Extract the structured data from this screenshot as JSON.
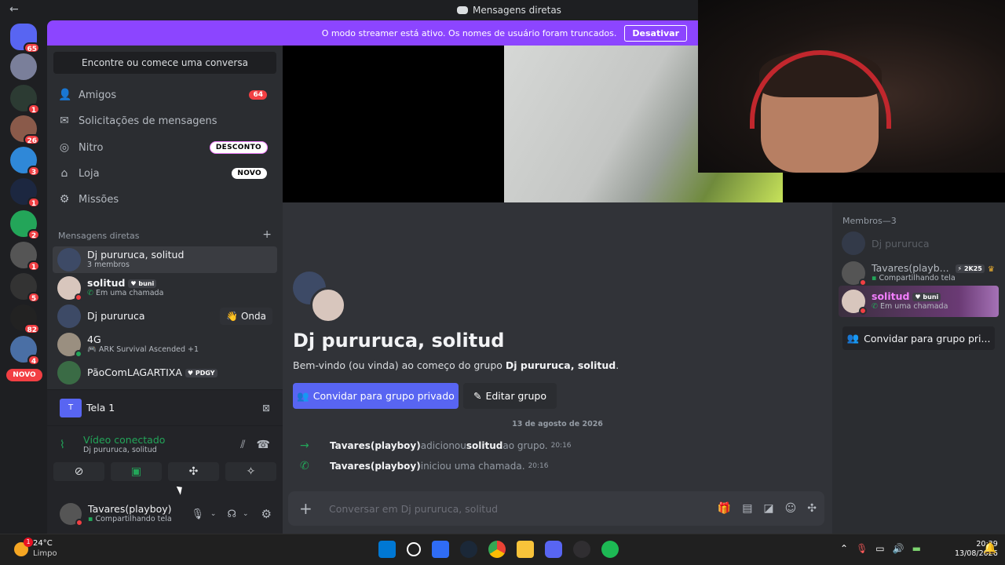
{
  "titlebar": {
    "back": "←",
    "title": "Mensagens diretas"
  },
  "rail": {
    "badges": [
      "65",
      "1",
      "26",
      "3",
      "1",
      "2",
      "1",
      "5",
      "82",
      "4"
    ],
    "new_label": "NOVO"
  },
  "banner": {
    "text": "O modo streamer está ativo. Os nomes de usuário foram truncados.",
    "button": "Desativar"
  },
  "sidebar": {
    "search": "Encontre ou comece uma conversa",
    "nav": [
      {
        "label": "Amigos",
        "badge": "64",
        "icon": "friends-icon"
      },
      {
        "label": "Solicitações de mensagens",
        "icon": "mail-icon"
      },
      {
        "label": "Nitro",
        "badge": "DESCONTO",
        "icon": "nitro-icon"
      },
      {
        "label": "Loja",
        "badge": "NOVO",
        "icon": "shop-icon"
      },
      {
        "label": "Missões",
        "icon": "quests-icon"
      }
    ],
    "dm_header": "Mensagens diretas",
    "dm_add": "+",
    "dms": [
      {
        "name": "Dj pururuca, solitud",
        "sub": "3 membros"
      },
      {
        "name": "solitud",
        "tag": "buni",
        "sub": "Em uma chamada"
      },
      {
        "name": "Dj pururuca",
        "action": "Onda"
      },
      {
        "name": "4G",
        "sub": "ARK Survival Ascended +1"
      },
      {
        "name": "PãoComLAGARTIXA",
        "tag": "PDGY"
      }
    ]
  },
  "voice": {
    "screen_label": "Tela 1",
    "screen_icon_text": "T",
    "status": "Vídeo conectado",
    "channel": "Dj pururuca, solitud",
    "user_name": "Tavares(playboy)",
    "user_status": "Compartilhando tela"
  },
  "main": {
    "group_title": "Dj pururuca, solitud",
    "welcome_prefix": "Bem-vindo (ou vinda) ao começo do grupo ",
    "welcome_group": "Dj pururuca, solitud",
    "welcome_suffix": ".",
    "invite_button": "Convidar para grupo privado",
    "edit_button": "Editar grupo",
    "date_separator": "13 de agosto de 2026",
    "messages": [
      {
        "who": "Tavares(playboy)",
        "text": " adicionou ",
        "target": "solitud",
        "tail": " ao grupo.",
        "time": "20:16"
      },
      {
        "who": "Tavares(playboy)",
        "text": " iniciou uma chamada.",
        "target": "",
        "tail": "",
        "time": "20:16"
      }
    ],
    "composer_placeholder": "Conversar em Dj pururuca, solitud"
  },
  "members": {
    "header": "Membros—3",
    "list": [
      {
        "name": "Dj pururuca",
        "sub": ""
      },
      {
        "name": "Tavares(playb...",
        "badge": "2K25",
        "sub": "Compartilhando tela"
      },
      {
        "name": "solitud",
        "tag": "buni",
        "sub": "Em uma chamada"
      }
    ],
    "invite": "Convidar para grupo pri..."
  },
  "taskbar": {
    "temp": "24°C",
    "weather": "Limpo",
    "weather_badge": "1",
    "time": "20:39",
    "date": "13/08/2026"
  },
  "colors": {
    "blurple": "#5865f2",
    "streamer_purple": "#8c45ff",
    "green": "#23a559",
    "red": "#f23f43"
  }
}
